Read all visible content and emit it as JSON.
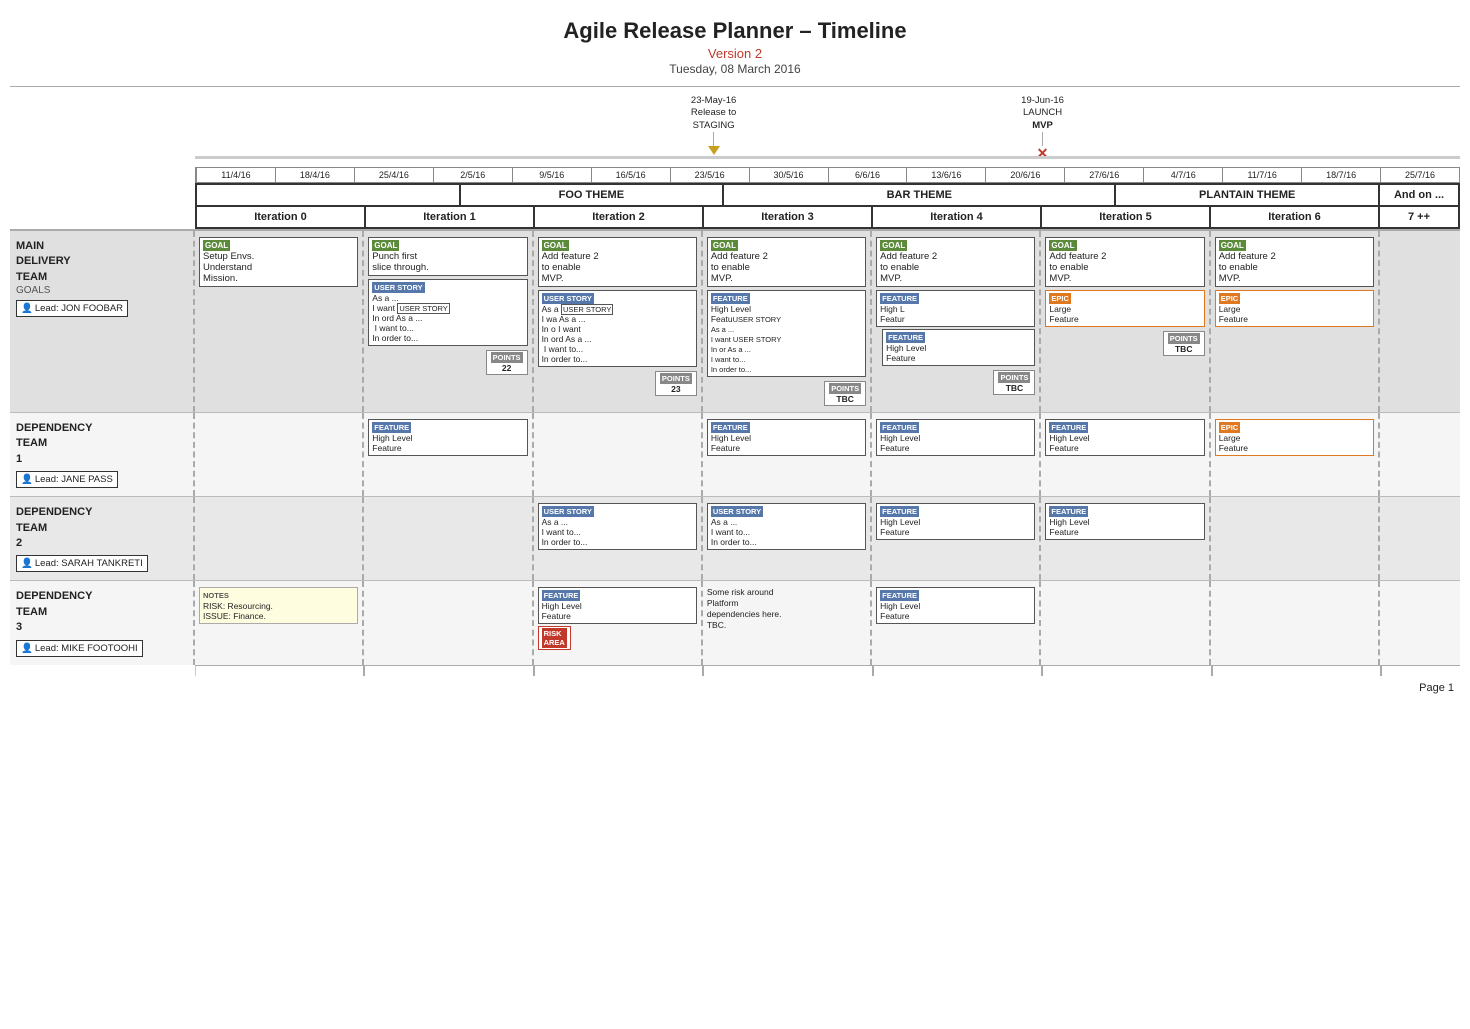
{
  "header": {
    "title": "Agile Release Planner – Timeline",
    "version": "Version 2",
    "date": "Tuesday, 08 March 2016"
  },
  "milestones": [
    {
      "id": "staging",
      "label": "23-May-16\nRelease to\nSTAGING",
      "type": "arrow_down",
      "pos_pct": 42
    },
    {
      "id": "mvp",
      "label": "19-Jun-16\nLAUNCH\nMVP",
      "type": "arrow_x",
      "pos_pct": 68
    }
  ],
  "dates": [
    "11/4/16",
    "18/4/16",
    "25/4/16",
    "2/5/16",
    "9/5/16",
    "16/5/16",
    "23/5/16",
    "30/5/16",
    "6/6/16",
    "13/6/16",
    "20/6/16",
    "27/6/16",
    "4/7/16",
    "11/7/16",
    "18/7/16",
    "25/7/16"
  ],
  "themes": [
    {
      "label": "FOO THEME",
      "span": 2
    },
    {
      "label": "BAR THEME",
      "span": 3
    },
    {
      "label": "PLANTAIN THEME",
      "span": 2
    }
  ],
  "and_on": "And on ...",
  "seven_plus": "7 ++",
  "iterations": [
    {
      "label": "Iteration 0"
    },
    {
      "label": "Iteration 1"
    },
    {
      "label": "Iteration 2"
    },
    {
      "label": "Iteration 3"
    },
    {
      "label": "Iteration 4"
    },
    {
      "label": "Iteration 5"
    },
    {
      "label": "Iteration 6"
    }
  ],
  "teams": [
    {
      "name": "MAIN\nDELIVERY\nTEAM",
      "goals_label": "GOALS",
      "lead": "Lead: JON FOOBAR",
      "bg": "gray",
      "iterations": [
        {
          "cards": [
            {
              "type": "goal",
              "label": "GOAL",
              "text": "Setup Envs.\nUnderstand\nMission."
            }
          ],
          "points": null
        },
        {
          "cards": [
            {
              "type": "goal",
              "label": "GOAL",
              "text": "Punch first\nslice through."
            },
            {
              "type": "user_story",
              "label": "USER STORY",
              "text": "As a ...\nI want USER STORY\nIn ord As a ...\n I want to...\nIn order to..."
            },
            {
              "type": "user_story",
              "label": "USER STORY",
              "text": "As a ...\n I want to...\nIn order to..."
            }
          ],
          "points": "22"
        },
        {
          "cards": [
            {
              "type": "goal",
              "label": "GOAL",
              "text": "Add feature 2\nto enable\nMVP."
            },
            {
              "type": "user_story",
              "label": "USER STORY",
              "text": "As a USER STORY\nI wa As a ...\nIn o I want\nIn ord As a ...\n I want to...\nIn order to..."
            }
          ],
          "points": "23"
        },
        {
          "cards": [
            {
              "type": "goal",
              "label": "GOAL",
              "text": "Add feature 2\nto enable\nMVP."
            },
            {
              "type": "feature",
              "label": "FEATURE",
              "text": "High Level\nFeature USER STORY\n As a ...\nI want USER STORY\nIn or As a ...\nI want to...\nIn order to..."
            }
          ],
          "points": "TBC"
        },
        {
          "cards": [
            {
              "type": "goal",
              "label": "GOAL",
              "text": "Add feature 2\nto enable\nMVP."
            },
            {
              "type": "feature",
              "label": "FEATURE",
              "text": "High Level\nFeature"
            },
            {
              "type": "feature",
              "label": "FEATURE",
              "text": "High Level\nFeature"
            }
          ],
          "points": "TBC"
        },
        {
          "cards": [
            {
              "type": "goal",
              "label": "GOAL",
              "text": "Add feature 2\nto enable\nMVP."
            },
            {
              "type": "epic",
              "label": "EPIC",
              "text": "Large\nFeature"
            }
          ],
          "points": "TBC"
        },
        {
          "cards": [
            {
              "type": "goal",
              "label": "GOAL",
              "text": "Add feature 2\nto enable\nMVP."
            },
            {
              "type": "epic",
              "label": "EPIC",
              "text": "Large\nFeature"
            }
          ],
          "points": null
        }
      ]
    },
    {
      "name": "DEPENDENCY\nTEAM\n1",
      "lead": "Lead: JANE PASS",
      "bg": "white",
      "iterations": [
        {
          "cards": []
        },
        {
          "cards": [
            {
              "type": "feature",
              "label": "FEATURE",
              "text": "High Level\nFeature"
            }
          ]
        },
        {
          "cards": []
        },
        {
          "cards": [
            {
              "type": "feature",
              "label": "FEATURE",
              "text": "High Level\nFeature"
            }
          ]
        },
        {
          "cards": [
            {
              "type": "feature",
              "label": "FEATURE",
              "text": "High Level\nFeature"
            }
          ]
        },
        {
          "cards": [
            {
              "type": "feature",
              "label": "FEATURE",
              "text": "High Level\nFeature"
            }
          ]
        },
        {
          "cards": [
            {
              "type": "epic",
              "label": "EPIC",
              "text": "Large\nFeature"
            }
          ]
        }
      ]
    },
    {
      "name": "DEPENDENCY\nTEAM\n2",
      "lead": "Lead: SARAH TANKRETI",
      "bg": "gray",
      "iterations": [
        {
          "cards": []
        },
        {
          "cards": []
        },
        {
          "cards": [
            {
              "type": "user_story",
              "label": "USER STORY",
              "text": "As a ...\nI want to...\nIn order to..."
            }
          ]
        },
        {
          "cards": [
            {
              "type": "user_story",
              "label": "USER STORY",
              "text": "As a ...\nI want to...\nIn order to..."
            }
          ]
        },
        {
          "cards": [
            {
              "type": "feature",
              "label": "FEATURE",
              "text": "High Level\nFeature"
            }
          ]
        },
        {
          "cards": [
            {
              "type": "feature",
              "label": "FEATURE",
              "text": "High Level\nFeature"
            }
          ]
        },
        {
          "cards": []
        }
      ]
    },
    {
      "name": "DEPENDENCY\nTEAM\n3",
      "lead": "Lead: MIKE FOOTOOHI",
      "bg": "white",
      "iterations": [
        {
          "cards": [
            {
              "type": "notes",
              "label": "NOTES",
              "text": "RISK: Resourcing.\nISSUE: Finance."
            }
          ]
        },
        {
          "cards": []
        },
        {
          "cards": [
            {
              "type": "feature",
              "label": "FEATURE",
              "text": "High Level\nFeature"
            },
            {
              "type": "risk",
              "label": "RISK\nAREA",
              "text": ""
            }
          ]
        },
        {
          "cards": [
            {
              "type": "text_only",
              "label": "",
              "text": "Some risk around\nPlatform\ndependencies here.\nTBC."
            }
          ]
        },
        {
          "cards": [
            {
              "type": "feature",
              "label": "FEATURE",
              "text": "High Level\nFeature"
            }
          ]
        },
        {
          "cards": []
        },
        {
          "cards": []
        }
      ]
    }
  ],
  "page_num": "Page 1",
  "colors": {
    "goal_bg": "#5a8a3a",
    "story_bg": "#5577aa",
    "feature_bg": "#5577aa",
    "epic_bg": "#e07820",
    "risk_bg": "#c0392b",
    "version_color": "#c0392b"
  }
}
